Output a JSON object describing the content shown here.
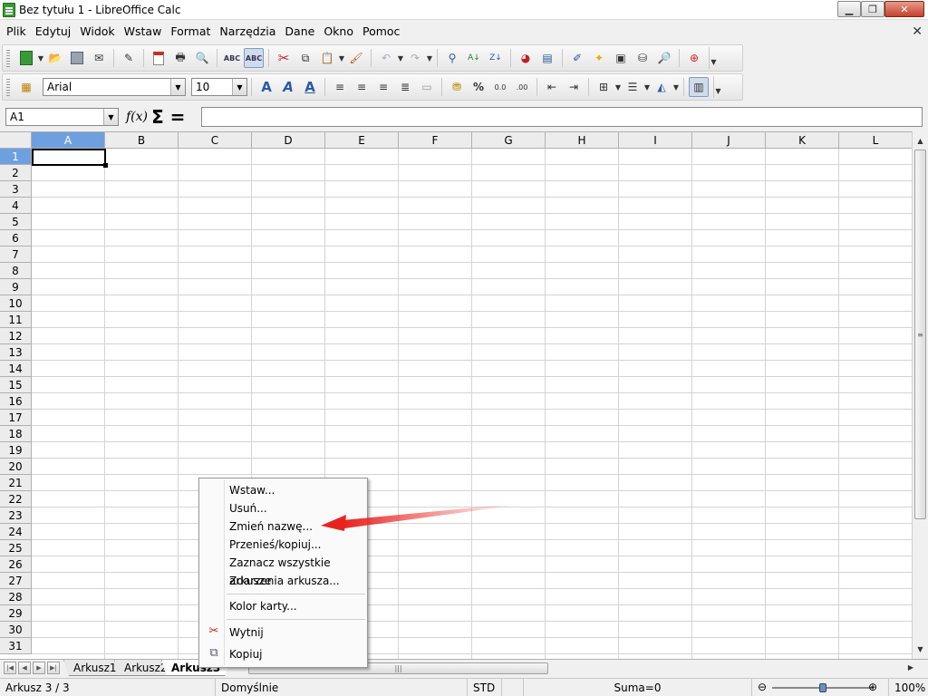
{
  "window": {
    "title": "Bez tytułu 1 - LibreOffice Calc",
    "app_icon": "calc-icon"
  },
  "menubar": {
    "items": [
      "Plik",
      "Edytuj",
      "Widok",
      "Wstaw",
      "Format",
      "Narzędzia",
      "Dane",
      "Okno",
      "Pomoc"
    ]
  },
  "format_toolbar": {
    "font_name": "Arial",
    "font_size": "10"
  },
  "formula_bar": {
    "name_box": "A1",
    "fx_label": "f(x)",
    "sum_label": "Σ",
    "equals_label": "=",
    "formula": ""
  },
  "grid": {
    "columns": [
      "A",
      "B",
      "C",
      "D",
      "E",
      "F",
      "G",
      "H",
      "I",
      "J",
      "K",
      "L"
    ],
    "rows": [
      "1",
      "2",
      "3",
      "4",
      "5",
      "6",
      "7",
      "8",
      "9",
      "10",
      "11",
      "12",
      "13",
      "14",
      "15",
      "16",
      "17",
      "18",
      "19",
      "20",
      "21",
      "22",
      "23",
      "24",
      "25",
      "26",
      "27",
      "28",
      "29",
      "30",
      "31"
    ],
    "selected_column": "A",
    "selected_row": "1"
  },
  "context_menu": {
    "items": [
      {
        "label": "Wstaw...",
        "icon": ""
      },
      {
        "label": "Usuń...",
        "icon": ""
      },
      {
        "label": "Zmień nazwę...",
        "icon": ""
      },
      {
        "label": "Przenieś/kopiuj...",
        "icon": ""
      },
      {
        "label": "Zaznacz wszystkie arkusze",
        "icon": ""
      },
      {
        "label": "Zdarzenia arkusza...",
        "icon": ""
      },
      {
        "label": "Kolor karty...",
        "icon": ""
      },
      {
        "label": "Wytnij",
        "icon": "scissors-icon"
      },
      {
        "label": "Kopiuj",
        "icon": "copy-icon"
      }
    ],
    "highlight_color": "#e8231e"
  },
  "sheet_tabs": {
    "tabs": [
      "Arkusz1",
      "Arkusz2",
      "Arkusz3"
    ],
    "active": "Arkusz3"
  },
  "statusbar": {
    "sheet": "Arkusz 3 / 3",
    "style": "Domyślnie",
    "mode": "STD",
    "sum": "Suma=0",
    "zoom": "100%"
  }
}
